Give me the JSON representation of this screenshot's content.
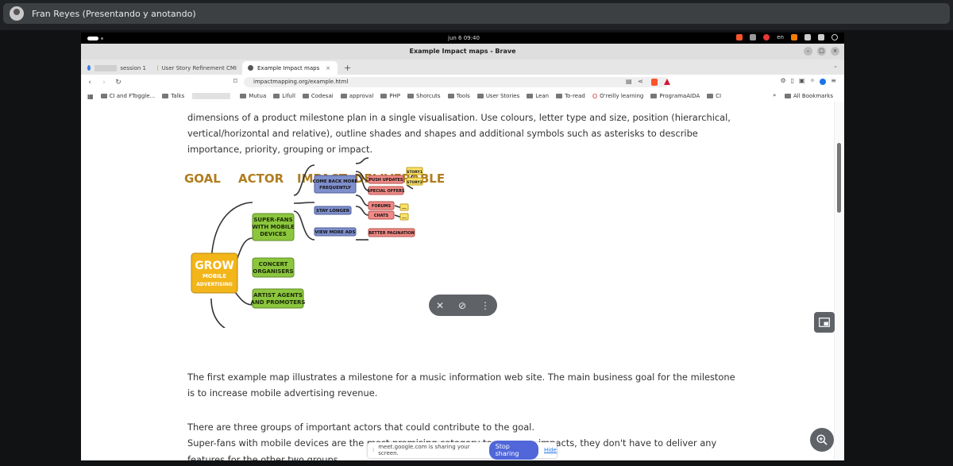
{
  "meet": {
    "presenter_name": "Fran Reyes (Presentando y anotando)",
    "share_text": "meet.google.com is sharing your screen.",
    "stop_label": "Stop sharing",
    "hide_label": "Hide"
  },
  "os": {
    "clock": "jun 6  09:40",
    "lang": "en"
  },
  "browser": {
    "window_title": "Example Impact maps - Brave",
    "tabs": [
      {
        "label": "session 1",
        "active": false
      },
      {
        "label": "User Story Refinement CMI",
        "active": false
      },
      {
        "label": "Example Impact maps",
        "active": true
      }
    ],
    "new_tab_label": "+",
    "url": "impactmapping.org/example.html",
    "bookmarks": [
      "CI and FToggle...",
      "Talks",
      "Mutua",
      "Lifull",
      "Codesai",
      "approval",
      "PHP",
      "Shorcuts",
      "Tools",
      "User Stories",
      "Lean",
      "To-read",
      "O'reilly learning",
      "ProgramaAIDA",
      "CI"
    ],
    "more_bookmarks": "»",
    "all_bookmarks": "All Bookmarks"
  },
  "page": {
    "intro_text": "dimensions of a product milestone plan in a single visualisation. Use colours, letter type and size, position (hierarchical, vertical/horizontal and relative), outline shades and shapes and additional symbols such as asterisks to describe importance, priority, grouping or impact.",
    "para1": "The first example map illustrates a milestone for a music information web site. The main business goal for the milestone is to increase mobile advertising revenue.",
    "para2": "There are three groups of important actors that could contribute to the goal. Super-fans with mobile devices are the most promising category to influence, so the map lists impacts for them f",
    "para2_right": "impacts, they don't have to deliver any",
    "para3": "features for the other two groups."
  },
  "map": {
    "headers": [
      "GOAL",
      "ACTOR",
      "IMPACT",
      "DELIVERABLE"
    ],
    "goal": [
      "GROW",
      "MOBILE",
      "ADVERTISING"
    ],
    "actors": [
      [
        "SUPER-FANS",
        "WITH MOBILE",
        "DEVICES"
      ],
      [
        "CONCERT",
        "ORGANISERS"
      ],
      [
        "ARTIST AGENTS",
        "AND PROMOTERS"
      ]
    ],
    "impacts": [
      [
        "COME BACK MORE",
        "FREQUENTLY"
      ],
      [
        "STAY LONGER"
      ],
      [
        "VIEW MORE ADS"
      ]
    ],
    "deliverables": [
      "PUSH UPDATES",
      "SPECIAL OFFERS",
      "FORUMS",
      "CHATS",
      "BETTER PAGINATION"
    ],
    "stories": [
      "STORY1",
      "STORY2"
    ],
    "ellipsis": "..."
  },
  "colors": {
    "goal": "#f2b51a",
    "actor": "#8cc63e",
    "impact": "#7e8fcc",
    "deliverable": "#f08a86",
    "story": "#fbe26a",
    "header": "#b07d1e"
  }
}
